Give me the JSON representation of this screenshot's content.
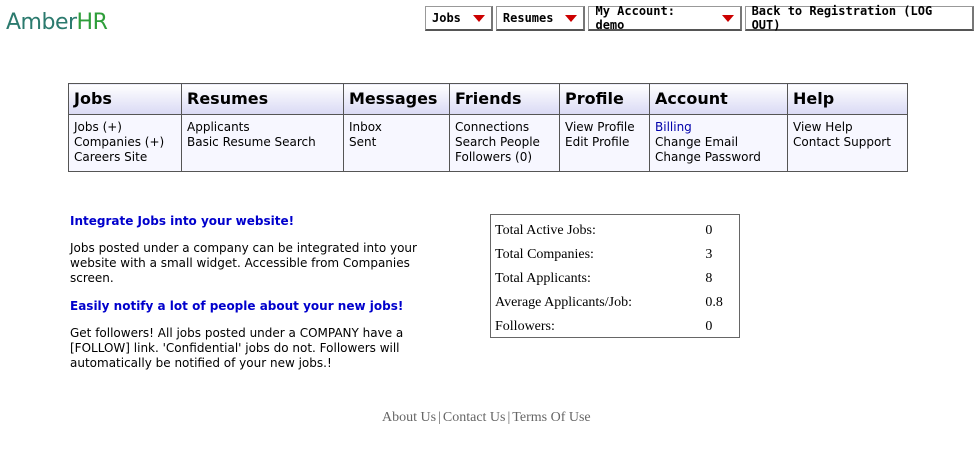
{
  "logo": {
    "part1": "Amber",
    "part2": "HR"
  },
  "topnav": [
    {
      "label": "Jobs",
      "dropdown": true
    },
    {
      "label": "Resumes",
      "dropdown": true
    },
    {
      "label": "My Account: demo",
      "dropdown": true
    },
    {
      "label": "Back to Registration (LOG OUT)",
      "dropdown": false
    }
  ],
  "menu": {
    "columns": [
      {
        "header": "Jobs",
        "items": [
          "Jobs (+)",
          "Companies (+)",
          "Careers Site"
        ]
      },
      {
        "header": "Resumes",
        "items": [
          "Applicants",
          "Basic Resume Search"
        ]
      },
      {
        "header": "Messages",
        "items": [
          "Inbox",
          "Sent"
        ]
      },
      {
        "header": "Friends",
        "items": [
          "Connections",
          "Search People",
          "Followers (0)"
        ]
      },
      {
        "header": "Profile",
        "items": [
          "View Profile",
          "Edit Profile"
        ]
      },
      {
        "header": "Account",
        "items": [
          "Billing",
          "Change Email",
          "Change Password"
        ]
      },
      {
        "header": "Help",
        "items": [
          "View Help",
          "Contact Support"
        ]
      }
    ]
  },
  "info": {
    "heading1": "Integrate Jobs into your website!",
    "text1": "Jobs posted under a company can be integrated into your website with a small widget. Accessible from Companies screen.",
    "heading2": "Easily notify a lot of people about your new jobs!",
    "text2": "Get followers! All jobs posted under a COMPANY have a [FOLLOW] link. 'Confidential' jobs do not. Followers will automatically be notified of your new jobs.!"
  },
  "stats": [
    {
      "label": "Total Active Jobs:",
      "value": "0"
    },
    {
      "label": "Total Companies:",
      "value": "3"
    },
    {
      "label": "Total Applicants:",
      "value": "8"
    },
    {
      "label": "Average Applicants/Job:",
      "value": "0.8"
    },
    {
      "label": "Followers:",
      "value": "0"
    }
  ],
  "footer": {
    "about": "About Us",
    "contact": "Contact Us",
    "terms": "Terms Of Use",
    "sep": "|"
  },
  "colors": {
    "accent_link": "#0000cc",
    "arrow": "#cc0000",
    "menu_header_bg": "#d9d9f4"
  }
}
